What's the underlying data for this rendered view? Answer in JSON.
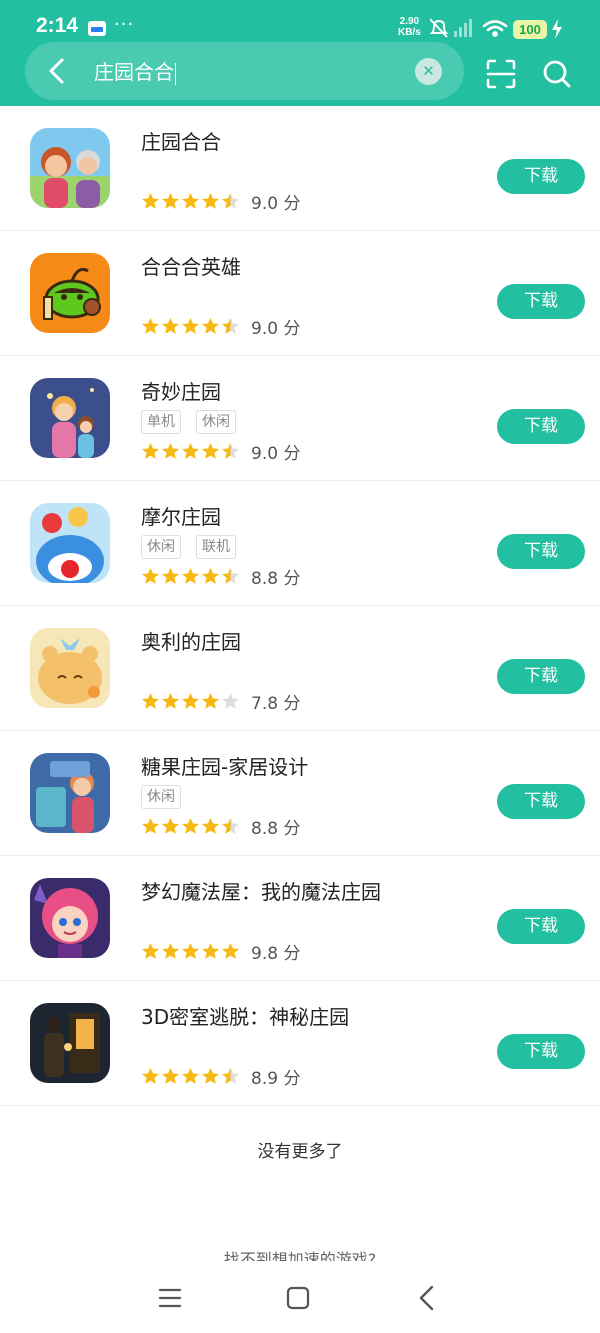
{
  "status": {
    "time": "2:14",
    "dots": "···",
    "net_speed_value": "2.90",
    "net_speed_unit": "KB/s",
    "battery": "100",
    "icons": [
      "app-notification-icon",
      "mute-icon",
      "no-signal-icon",
      "wifi-icon",
      "battery-icon",
      "charging-icon"
    ]
  },
  "search": {
    "query": "庄园合合",
    "icons": [
      "back-arrow-icon",
      "clear-icon",
      "scan-icon",
      "search-icon"
    ]
  },
  "apps": [
    {
      "name": "庄园合合",
      "tags": [],
      "stars": 4.5,
      "score": "9.0 分",
      "button": "下载"
    },
    {
      "name": "合合合英雄",
      "tags": [],
      "stars": 4.5,
      "score": "9.0 分",
      "button": "下载"
    },
    {
      "name": "奇妙庄园",
      "tags": [
        "单机",
        "休闲"
      ],
      "stars": 4.5,
      "score": "9.0 分",
      "button": "下载"
    },
    {
      "name": "摩尔庄园",
      "tags": [
        "休闲",
        "联机"
      ],
      "stars": 4.5,
      "score": "8.8 分",
      "button": "下载"
    },
    {
      "name": "奥利的庄园",
      "tags": [],
      "stars": 4,
      "score": "7.8 分",
      "button": "下载"
    },
    {
      "name": "糖果庄园-家居设计",
      "tags": [
        "休闲"
      ],
      "stars": 4.5,
      "score": "8.8 分",
      "button": "下载"
    },
    {
      "name": "梦幻魔法屋：我的魔法庄园",
      "tags": [],
      "stars": 5,
      "score": "9.8 分",
      "button": "下载"
    },
    {
      "name": "3D密室逃脱：神秘庄园",
      "tags": [],
      "stars": 4.5,
      "score": "8.9 分",
      "button": "下载"
    }
  ],
  "footer": {
    "no_more": "没有更多了",
    "hint": "找不到想加速的游戏?"
  },
  "nav": {
    "icons": [
      "menu-icon",
      "home-icon",
      "back-icon"
    ]
  },
  "colors": {
    "accent": "#22bfa0",
    "star": "#f6b812",
    "star_empty": "#dddddd"
  }
}
